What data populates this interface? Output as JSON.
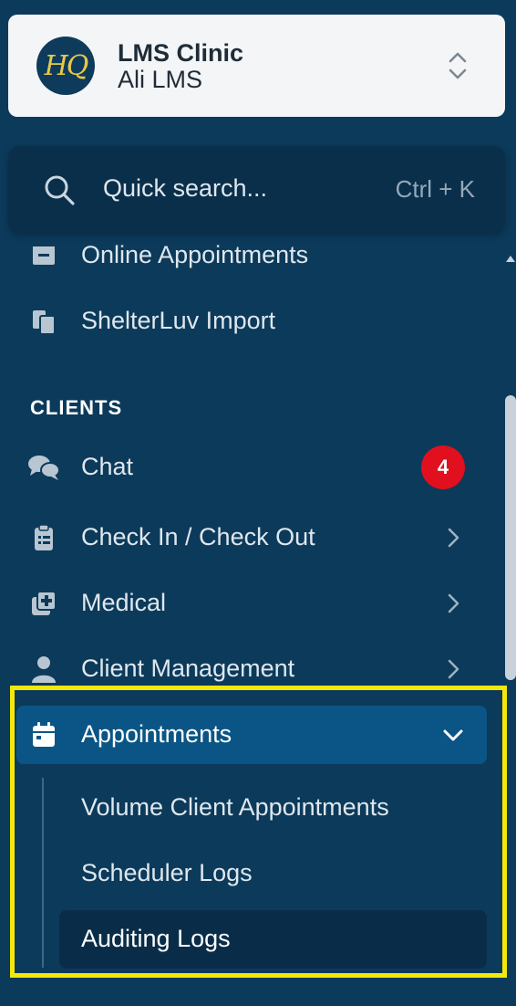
{
  "org": {
    "name": "LMS Clinic",
    "user": "Ali LMS",
    "logo_text": "HQ",
    "logo_color": "#e7c84a"
  },
  "search": {
    "placeholder": "Quick search...",
    "shortcut": "Ctrl + K",
    "icon": "search-icon"
  },
  "nav": {
    "top_items": [
      {
        "label": "Online Appointments",
        "icon": "calendar-box-icon"
      },
      {
        "label": "ShelterLuv Import",
        "icon": "clipboard-copy-icon"
      }
    ],
    "section_clients": "CLIENTS",
    "client_items": [
      {
        "label": "Chat",
        "icon": "chat-icon",
        "badge": "4"
      },
      {
        "label": "Check In / Check Out",
        "icon": "clipboard-list-icon",
        "expandable": true
      },
      {
        "label": "Medical",
        "icon": "medical-plus-icon",
        "expandable": true
      },
      {
        "label": "Client Management",
        "icon": "user-icon",
        "expandable": true
      },
      {
        "label": "Appointments",
        "icon": "calendar-icon",
        "expanded": true,
        "active": true
      }
    ],
    "appointments_sub": [
      {
        "label": "Volume Client Appointments"
      },
      {
        "label": "Scheduler Logs"
      },
      {
        "label": "Auditing Logs",
        "current": true
      }
    ]
  },
  "colors": {
    "sidebar_bg": "#0c3a5a",
    "active_bg": "#0a5585",
    "badge": "#e0101e",
    "highlight": "#f4e80a"
  }
}
